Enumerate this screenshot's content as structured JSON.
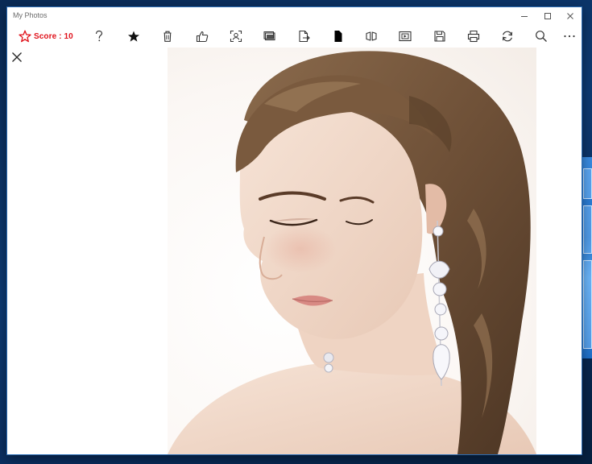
{
  "window": {
    "title": "My Photos",
    "controls": [
      "minimize",
      "maximize",
      "close"
    ]
  },
  "toolbar": {
    "score_label": "Score : 10",
    "score_color": "#e0121b",
    "buttons": [
      {
        "name": "help",
        "icon": "question-icon"
      },
      {
        "name": "favorite",
        "icon": "star-icon"
      },
      {
        "name": "delete",
        "icon": "trash-icon"
      },
      {
        "name": "like",
        "icon": "thumbs-up-icon"
      },
      {
        "name": "face-detect",
        "icon": "face-scan-icon"
      },
      {
        "name": "slideshow",
        "icon": "gallery-icon"
      },
      {
        "name": "export",
        "icon": "file-export-icon"
      },
      {
        "name": "crop",
        "icon": "crop-rectangle-icon"
      },
      {
        "name": "compare",
        "icon": "compare-icon"
      },
      {
        "name": "present",
        "icon": "presentation-icon"
      },
      {
        "name": "save",
        "icon": "save-icon"
      },
      {
        "name": "print",
        "icon": "printer-icon"
      },
      {
        "name": "refresh",
        "icon": "refresh-icon"
      },
      {
        "name": "search",
        "icon": "search-icon"
      },
      {
        "name": "more",
        "icon": "more-icon"
      }
    ]
  },
  "viewer": {
    "close_icon": "close-icon",
    "photo": {
      "subject": "portrait of a woman with wavy brown hair and a crystal drop earring"
    }
  },
  "colors": {
    "accent": "#e0121b",
    "window_bg": "#ffffff",
    "desktop": "#0b2b52"
  }
}
